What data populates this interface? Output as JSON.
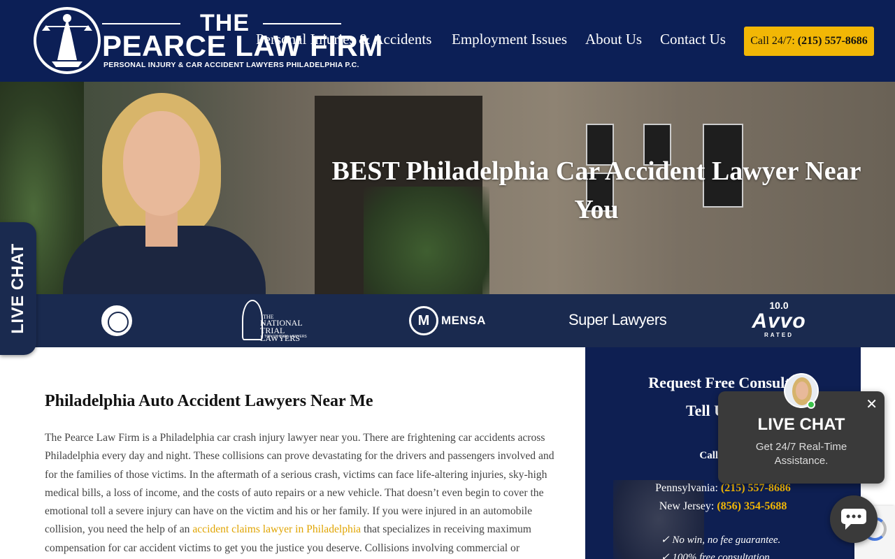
{
  "header": {
    "logo": {
      "the": "THE",
      "name": "PEARCE LAW FIRM",
      "tagline": "PERSONAL INJURY & CAR ACCIDENT LAWYERS PHILADELPHIA P.C."
    },
    "nav": [
      {
        "label": "Personal Injuries & Accidents"
      },
      {
        "label": "Employment Issues"
      },
      {
        "label": "About Us"
      },
      {
        "label": "Contact Us"
      }
    ],
    "call": {
      "prefix": "Call 24/7:",
      "phone": "(215) 557-8686",
      "color": "#f2b705"
    },
    "background": "#0c1f56"
  },
  "hero": {
    "title": "BEST Philadelphia Car Accident Lawyer Near You"
  },
  "badges": {
    "ntl": {
      "the": "THE",
      "name": "NATIONAL TRIAL LAWYERS",
      "sub": "TOP 100 TRIAL LAWYERS"
    },
    "mensa": {
      "letter": "M",
      "name": "MENSA"
    },
    "super_lawyers": "Super Lawyers",
    "avvo": {
      "score": "10.0",
      "name": "Avvo",
      "rated": "RATED"
    }
  },
  "side_tab": {
    "label": "LIVE CHAT"
  },
  "main": {
    "heading": "Philadelphia Auto Accident Lawyers Near Me",
    "para_before": "The Pearce Law Firm is a Philadelphia car crash injury lawyer near you. There are frightening car accidents across Philadelphia every day and night. These collisions can prove devastating for the drivers and passengers involved and for the families of those victims. In the aftermath of a serious crash, victims can face life-altering injuries, sky-high medical bills, a loss of income, and the costs of auto repairs or a new vehicle. That doesn’t even begin to cover the emotional toll a severe injury can have on the victim and his or her family. If you were injured in an automobile collision, you need the help of an ",
    "para_link": "accident claims lawyer in Philadelphia",
    "para_after": " that specializes in receiving maximum compensation for car accident victims to get you the justice you deserve. Collisions involving commercial or"
  },
  "sidebar": {
    "heading1": "Request Free Consulta",
    "heading2": "Tell Us You",
    "call_text": "Call or em",
    "pa_label": "Pennsylvania:",
    "pa_phone": "(215) 557-8686",
    "nj_label": "New Jersey:",
    "nj_phone": "(856) 354-5688",
    "check1": "✓ No win, no fee guarantee.",
    "check2": "✓ 100% free consultation."
  },
  "chat_popup": {
    "close": "✕",
    "title": "LIVE CHAT",
    "subtitle": "Get 24/7 Real-Time Assistance."
  },
  "colors": {
    "navy": "#0c1f56",
    "gold": "#f2b705",
    "link": "#e0a400"
  }
}
